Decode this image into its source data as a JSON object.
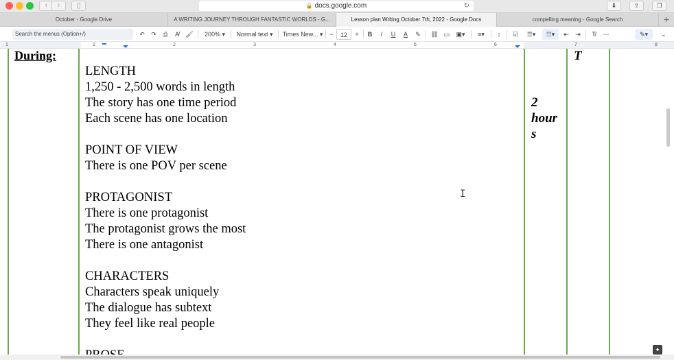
{
  "browser": {
    "url": "docs.google.com",
    "tabs": [
      {
        "label": "October - Google Drive",
        "active": false
      },
      {
        "label": "A WRITING JOURNEY THROUGH FANTASTIC WORLDS - G...",
        "active": false
      },
      {
        "label": "Lesson plan Writing October 7th, 2022 - Google Docs",
        "active": true
      },
      {
        "label": "compelling meaning - Google Search",
        "active": false
      }
    ],
    "new_tab": "+"
  },
  "toolbar": {
    "search_placeholder": "Search the menus (Option+/)",
    "zoom": "200%",
    "style": "Normal text",
    "font": "Times New...",
    "font_size": "12",
    "minus": "−",
    "plus": "+",
    "bold": "B",
    "italic": "I",
    "underline": "U",
    "text_color": "A"
  },
  "ruler": {
    "numbers": [
      "1",
      "1",
      "2",
      "3",
      "4",
      "5",
      "6",
      "7",
      "8"
    ]
  },
  "document": {
    "during_label": "During:",
    "right_col_letter": "T",
    "duration": [
      "2",
      "hour",
      "s"
    ],
    "lines": [
      "LENGTH",
      "1,250 - 2,500 words in length",
      "The story has one time period",
      "Each scene has one location",
      "",
      "POINT OF VIEW",
      "There is one POV per scene",
      "",
      "PROTAGONIST",
      "There is one protagonist",
      "The protagonist grows the most",
      "There is one antagonist",
      "",
      "CHARACTERS",
      "Characters speak uniquely",
      "The dialogue has subtext",
      "They feel like real people",
      "",
      "PROSE"
    ]
  },
  "colors": {
    "table_border": "#6aa84f",
    "mac_close": "#ff5f57",
    "mac_min": "#febc2e",
    "mac_max": "#28c840",
    "ruler_marker": "#1a73e8"
  }
}
